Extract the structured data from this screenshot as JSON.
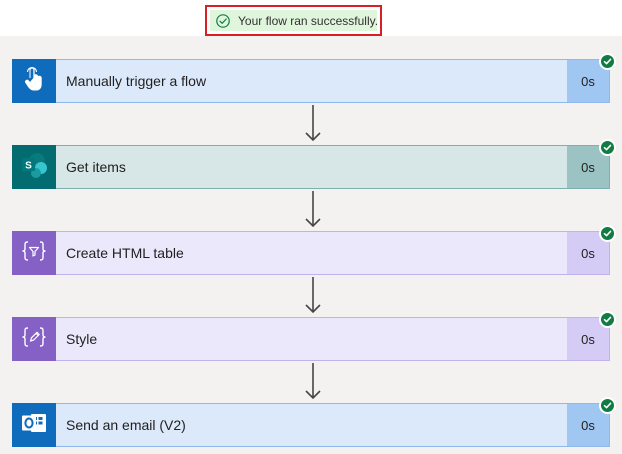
{
  "banner": {
    "text": "Your flow ran successfully.",
    "icon": "check-circle-icon"
  },
  "steps": [
    {
      "title": "Manually trigger a flow",
      "duration": "0s",
      "icon": "touch-hand-icon",
      "tile": "#0f6cbd",
      "body": "#dbe9fb",
      "border": "#8fb9ec",
      "dur_bg": "#a0c6f2"
    },
    {
      "title": "Get items",
      "duration": "0s",
      "icon": "sharepoint-icon",
      "tile": "#036c70",
      "body": "#d7e6e6",
      "border": "#7fb0b1",
      "dur_bg": "#9bc3c4"
    },
    {
      "title": "Create HTML table",
      "duration": "0s",
      "icon": "data-operation-icon",
      "tile": "#8661c5",
      "body": "#ece8fb",
      "border": "#c0b2ea",
      "dur_bg": "#d5ccf5"
    },
    {
      "title": "Style",
      "duration": "0s",
      "icon": "compose-icon",
      "tile": "#8661c5",
      "body": "#ece8fb",
      "border": "#c0b2ea",
      "dur_bg": "#d5ccf5"
    },
    {
      "title": "Send an email (V2)",
      "duration": "0s",
      "icon": "outlook-icon",
      "tile": "#0f6cbd",
      "body": "#dbe9fb",
      "border": "#8fb9ec",
      "dur_bg": "#a0c6f2"
    }
  ],
  "success_color": "#107c41"
}
